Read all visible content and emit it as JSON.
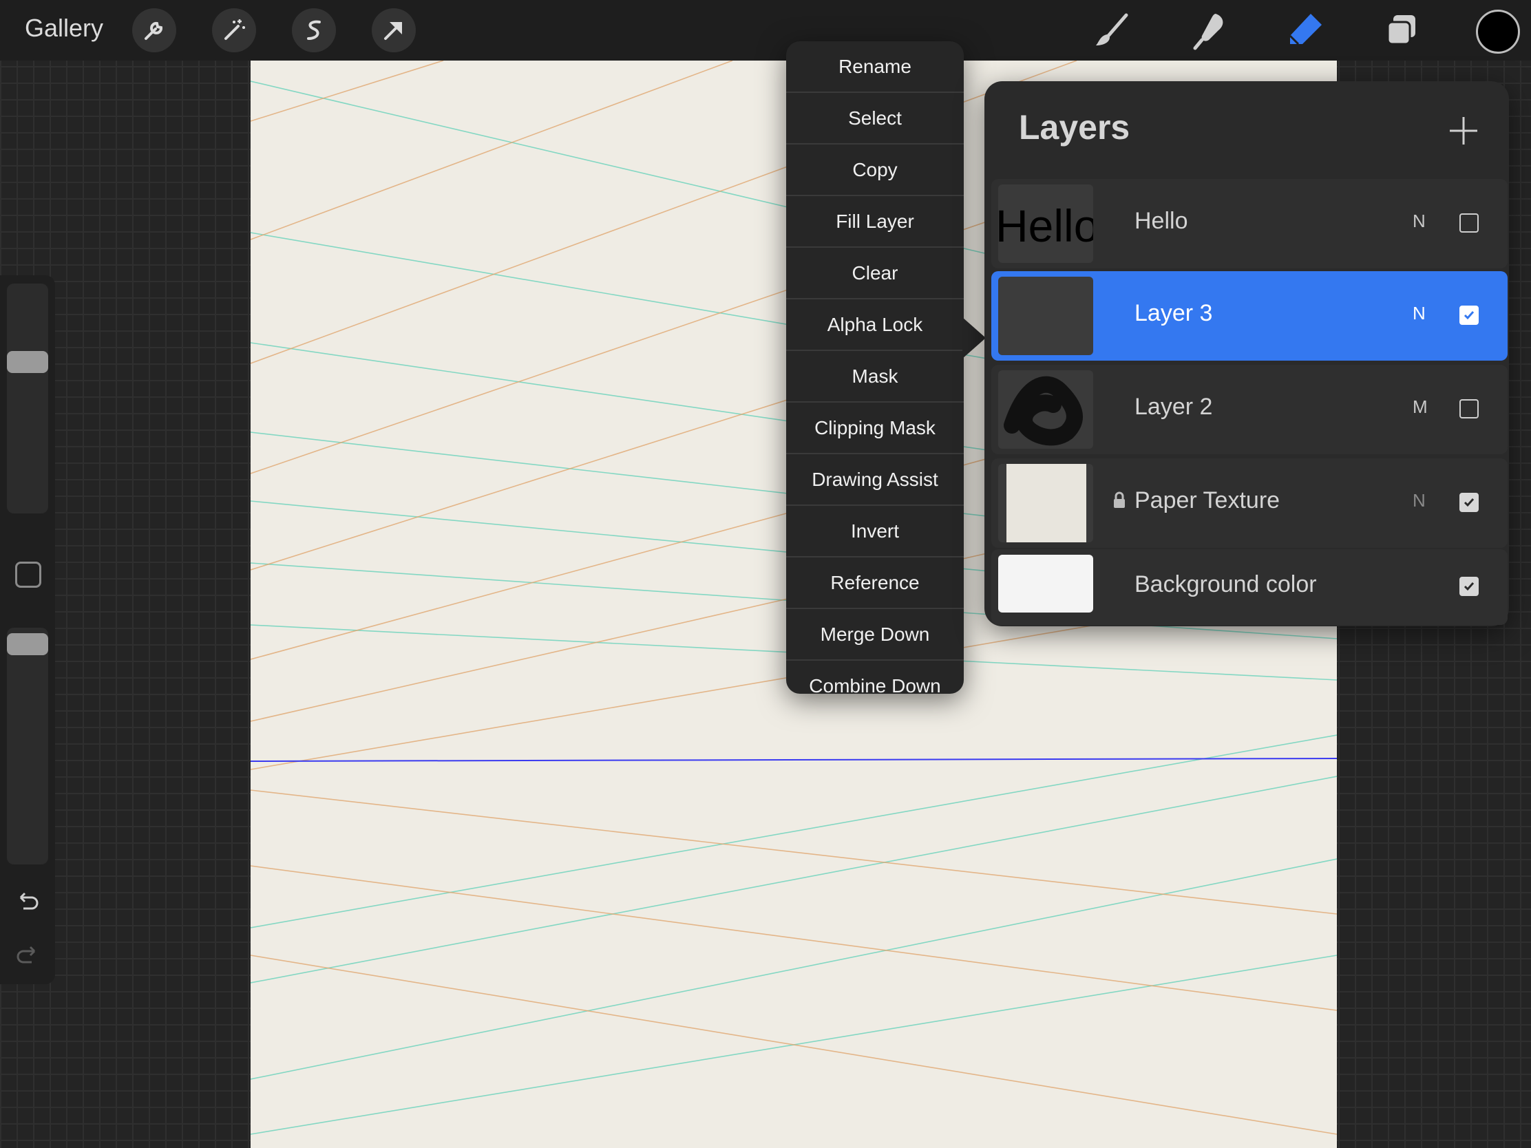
{
  "topbar": {
    "gallery_label": "Gallery",
    "left_tools": [
      "wrench-icon",
      "magic-wand-icon",
      "selection-icon",
      "transform-arrow-icon"
    ],
    "right_tools": [
      "brush-icon",
      "smudge-icon",
      "eraser-icon",
      "layers-icon"
    ],
    "active_tool": "eraser-icon",
    "active_color": "#000000"
  },
  "context_menu": {
    "items": [
      "Rename",
      "Select",
      "Copy",
      "Fill Layer",
      "Clear",
      "Alpha Lock",
      "Mask",
      "Clipping Mask",
      "Drawing Assist",
      "Invert",
      "Reference",
      "Merge Down",
      "Combine Down"
    ]
  },
  "layers_panel": {
    "title": "Layers",
    "layers": [
      {
        "name": "Hello",
        "blend": "N",
        "visible": false,
        "thumb_text": "Hello"
      },
      {
        "name": "Layer 3",
        "blend": "N",
        "visible": true,
        "selected": true
      },
      {
        "name": "Layer 2",
        "blend": "M",
        "visible": false
      },
      {
        "name": "Paper Texture",
        "blend": "N",
        "visible": true,
        "locked": true
      },
      {
        "name": "Background color",
        "blend": "",
        "visible": true
      }
    ]
  },
  "colors": {
    "accent": "#3478f0",
    "canvas": "#efece4",
    "guide_teal": "#5fd1b8",
    "guide_orange": "#e0a36a",
    "horizon": "#3a3af0"
  }
}
